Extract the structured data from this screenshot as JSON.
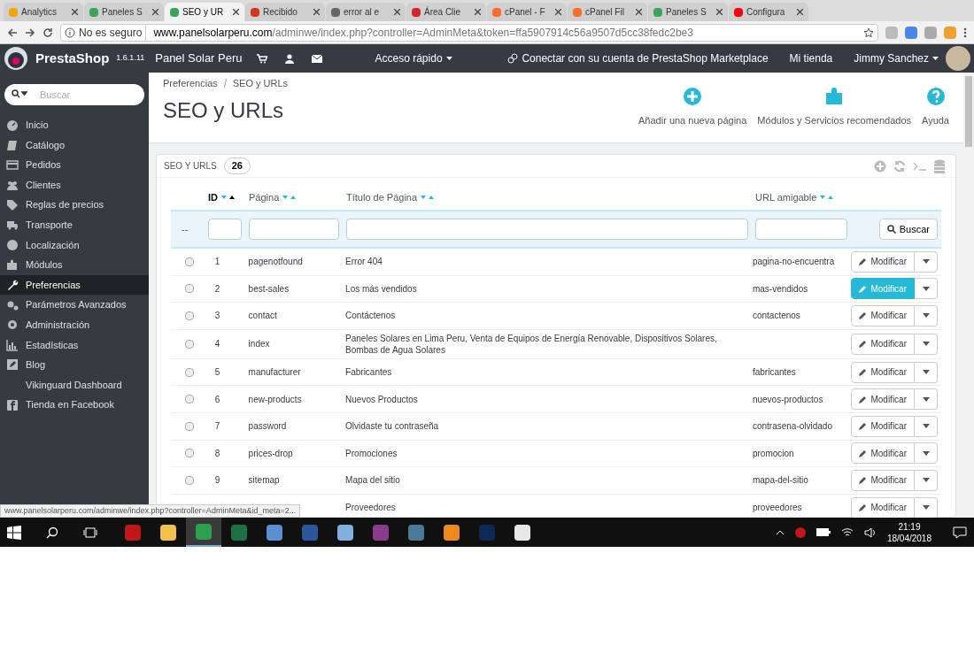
{
  "browser_tabs": [
    {
      "label": "Analytics",
      "color": "#f4a300",
      "selected": false
    },
    {
      "label": "Paneles S",
      "color": "#3aa55a",
      "selected": false
    },
    {
      "label": "SEO y UR",
      "color": "#3aa55a",
      "selected": true
    },
    {
      "label": "Recibido",
      "color": "#d93025",
      "selected": false
    },
    {
      "label": "error al e",
      "color": "#666666",
      "selected": false
    },
    {
      "label": "Área Clie",
      "color": "#d8232a",
      "selected": false
    },
    {
      "label": "cPanel - F",
      "color": "#ff6c2c",
      "selected": false
    },
    {
      "label": "cPanel Fil",
      "color": "#ff6c2c",
      "selected": false
    },
    {
      "label": "Paneles S",
      "color": "#3aa55a",
      "selected": false
    },
    {
      "label": "Configura",
      "color": "#ff0000",
      "selected": false
    }
  ],
  "address_bar": {
    "security": "No es seguro",
    "host": "www.panelsolarperu.com",
    "path": "/adminwe/index.php?controller=AdminMeta&token=ffa5907914c56a9507d5cc38fedc2be3"
  },
  "header": {
    "brand": "PrestaShop",
    "version": "1.6.1.11",
    "shop": "Panel Solar Peru",
    "quick_access": "Acceso rápido",
    "marketplace": "Conectar con su cuenta de PrestaShop Marketplace",
    "my_shop": "Mi tienda",
    "user": "Jimmy Sanchez"
  },
  "sidebar": {
    "search_placeholder": "Buscar",
    "items": [
      {
        "label": "Inicio",
        "kind": "dashboard",
        "selected": false
      },
      {
        "label": "Catálogo",
        "kind": "book",
        "selected": false
      },
      {
        "label": "Pedidos",
        "kind": "card",
        "selected": false
      },
      {
        "label": "Clientes",
        "kind": "users",
        "selected": false
      },
      {
        "label": "Reglas de precios",
        "kind": "tag",
        "selected": false
      },
      {
        "label": "Transporte",
        "kind": "truck",
        "selected": false
      },
      {
        "label": "Localización",
        "kind": "globe",
        "selected": false
      },
      {
        "label": "Módulos",
        "kind": "puzzle",
        "selected": false
      },
      {
        "label": "Preferencias",
        "kind": "wrench",
        "selected": true
      },
      {
        "label": "Parámetros Avanzados",
        "kind": "gears",
        "selected": false
      },
      {
        "label": "Administración",
        "kind": "gear",
        "selected": false
      },
      {
        "label": "Estadísticas",
        "kind": "chart",
        "selected": false
      },
      {
        "label": "Blog",
        "kind": "pencil",
        "selected": false
      },
      {
        "label": "Vikinguard Dashboard",
        "kind": "plain",
        "selected": false
      },
      {
        "label": "Tienda en Facebook",
        "kind": "facebook",
        "selected": false
      }
    ]
  },
  "breadcrumb": [
    "Preferencias",
    "SEO y URLs"
  ],
  "page_title": "SEO y URLs",
  "toolbar": [
    {
      "label": "Añadir una nueva página",
      "kind": "plus"
    },
    {
      "label": "Módulos y Servicios recomendados",
      "kind": "puzzle"
    },
    {
      "label": "Ayuda",
      "kind": "help"
    }
  ],
  "panel": {
    "title": "SEO Y URLS",
    "count": "26"
  },
  "table": {
    "columns": [
      "ID",
      "Página",
      "Título de Página",
      "URL amigable"
    ],
    "filter_marker": "--",
    "search_button": "Buscar",
    "rows": [
      {
        "checked": false,
        "id": "1",
        "page": "pagenotfound",
        "title": "Error 404",
        "url": "pagina-no-encuentra",
        "action": "Modificar",
        "highlighted": false
      },
      {
        "checked": false,
        "id": "2",
        "page": "best-sales",
        "title": "Los más vendidos",
        "url": "mas-vendidos",
        "action": "Modificar",
        "highlighted": true
      },
      {
        "checked": false,
        "id": "3",
        "page": "contact",
        "title": "Contáctenos",
        "url": "contactenos",
        "action": "Modificar",
        "highlighted": false
      },
      {
        "checked": false,
        "id": "4",
        "page": "index",
        "title": "Paneles Solares en Lima Peru, Venta de Equipos de Energía Renovable, Dispositivos Solares, Bombas de Agua Solares",
        "action": "Modificar",
        "highlighted": false
      },
      {
        "checked": false,
        "id": "5",
        "page": "manufacturer",
        "title": "Fabricantes",
        "url": "fabricantes",
        "action": "Modificar",
        "highlighted": false
      },
      {
        "checked": false,
        "id": "6",
        "page": "new-products",
        "title": "Nuevos Productos",
        "url": "nuevos-productos",
        "action": "Modificar",
        "highlighted": false
      },
      {
        "checked": false,
        "id": "7",
        "page": "password",
        "title": "Olvidaste tu contraseña",
        "url": "contrasena-olvidado",
        "action": "Modificar",
        "highlighted": false
      },
      {
        "checked": false,
        "id": "8",
        "page": "prices-drop",
        "title": "Promociones",
        "url": "promocion",
        "action": "Modificar",
        "highlighted": false
      },
      {
        "checked": false,
        "id": "9",
        "page": "sitemap",
        "title": "Mapa del sitio",
        "url": "mapa-del-sitio",
        "action": "Modificar",
        "highlighted": false
      },
      {
        "title": "Proveedores",
        "url": "proveedores",
        "action": "Modificar",
        "highlighted": false
      }
    ]
  },
  "status_url": "www.panelsolarperu.com/adminwe/index.php?controller=AdminMeta&id_meta=2...",
  "taskbar": {
    "apps": [
      {
        "color": "#c01818",
        "active": false
      },
      {
        "color": "#f3c14b",
        "active": false
      },
      {
        "color": "#2e9e4f",
        "active": true
      },
      {
        "color": "#1d7044",
        "active": false
      },
      {
        "color": "#5a8fd0",
        "active": false
      },
      {
        "color": "#2b579a",
        "active": false
      },
      {
        "color": "#7fb0e0",
        "active": false
      },
      {
        "color": "#8a3c8c",
        "active": false
      },
      {
        "color": "#4a7a9a",
        "active": false
      },
      {
        "color": "#ee8a1c",
        "active": false
      },
      {
        "color": "#0b2a57",
        "active": false
      },
      {
        "color": "#e8e8e8",
        "active": false
      }
    ],
    "time": "21:19",
    "date": "18/04/2018"
  }
}
